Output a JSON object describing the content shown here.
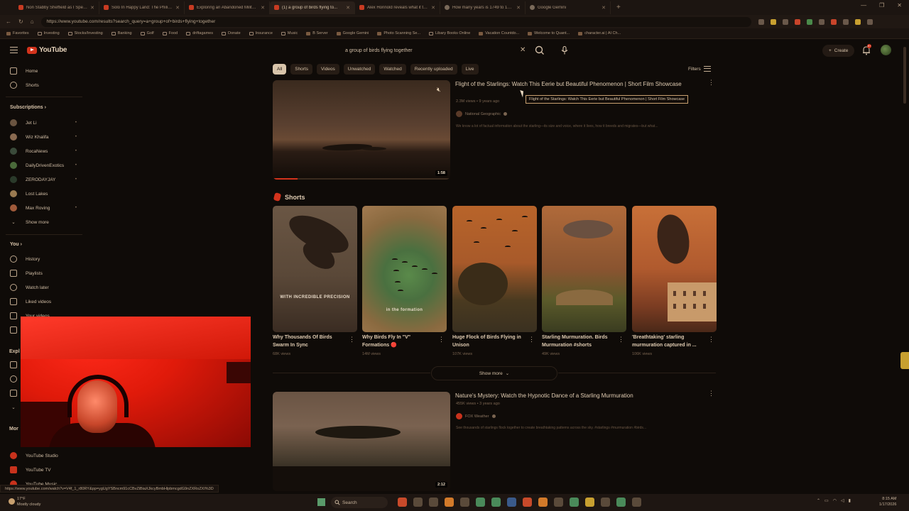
{
  "browser": {
    "tabs": [
      {
        "label": "Non Stabby Sheffield as I Speak &...",
        "icon": "youtube-icon"
      },
      {
        "label": "Solo In Happy Land: The Philippine...",
        "icon": "youtube-icon"
      },
      {
        "label": "Exploring an Abandoned Military ...",
        "icon": "youtube-icon"
      },
      {
        "label": "(1) a group of birds flying to...",
        "icon": "youtube-icon",
        "active": true
      },
      {
        "label": "Alex Honnold reveals what it takes...",
        "icon": "youtube-icon"
      },
      {
        "label": "How many years is 1749 to 1841?",
        "icon": "gemini-icon"
      },
      {
        "label": "Google Gemini",
        "icon": "gemini-icon"
      }
    ],
    "url": "https://www.youtube.com/results?search_query=a+group+of+birds+flying+together",
    "bookmarks": [
      "Favorites",
      "Investing",
      "Stocks/Investing",
      "Banking",
      "Golf",
      "Food",
      "driftagames",
      "Donate",
      "Insurance",
      "Music",
      "B Server",
      "Google Gemini",
      "Photo Scanning Se...",
      "Libary Books Online",
      "Vacation Countdo...",
      "Welcome to Quant...",
      "character.ai | AI Ch..."
    ],
    "status_url": "https://www.youtube.com/watch?v=V4f_1_r80RY&pp=ygUgYSBncm91cCBvZiBiaXJkcyBmbHlpbmcgdG9nZXRoZXI%3D"
  },
  "youtube": {
    "logo": "YouTube",
    "search_query": "a group of birds flying together",
    "create_label": "Create",
    "notification_count": "9+",
    "accent": "#d3331c"
  },
  "sidebar": {
    "home": "Home",
    "shorts": "Shorts",
    "subscriptions_head": "Subscriptions",
    "channels": [
      "Jet Li",
      "Wiz Khalifa",
      "RocaNews",
      "DailyDrivenExotics",
      "ZERODAYJAY",
      "Lost Lakes",
      "Max Roving"
    ],
    "show_more": "Show more",
    "you_head": "You",
    "you_items": [
      "History",
      "Playlists",
      "Watch later",
      "Liked videos",
      "Your videos"
    ],
    "explore_head": "Expl",
    "more_head": "Mor",
    "more_items": [
      "YouTube Studio",
      "YouTube TV",
      "YouTube Music"
    ]
  },
  "filters": {
    "chips": [
      "All",
      "Shorts",
      "Videos",
      "Unwatched",
      "Watched",
      "Recently uploaded",
      "Live"
    ],
    "filters_label": "Filters"
  },
  "results": {
    "video1": {
      "title": "Flight of the Starlings: Watch This Eerie but Beautiful Phenomenon | Short Film Showcase",
      "meta": "2.3M views • 9 years ago",
      "channel": "National Geographic",
      "description": "We know a lot of factual information about the starling—its size and voice, where it lives, how it breeds and migrates—but what...",
      "duration": "1:58",
      "tooltip": "Flight of the Starlings: Watch This Eerie but Beautiful Phenomenon | Short Film Showcase",
      "progress_fraction": 0.14
    },
    "shorts_head": "Shorts",
    "shorts": [
      {
        "title": "Why Thousands Of Birds Swarm In Sync",
        "views": "68K views",
        "caption": "WITH INCREDIBLE PRECISION"
      },
      {
        "title": "Why Birds Fly In \"V\" Formations 🔴",
        "views": "14M views",
        "caption": "in the formation"
      },
      {
        "title": "Huge Flock of Birds Flying in Unison",
        "views": "107K views",
        "caption": ""
      },
      {
        "title": "Starling Murmuration. Birds Murmuration #shorts",
        "views": "49K views",
        "caption": ""
      },
      {
        "title": "'Breathtaking' starling murmuration captured in ...",
        "views": "106K views",
        "caption": ""
      }
    ],
    "show_more": "Show more",
    "video2": {
      "title": "Nature's Mystery: Watch the Hypnotic Dance of a Starling Murmuration",
      "meta": "455K views • 3 years ago",
      "channel": "FOX Weather",
      "description": "See thousands of starlings flock together to create breathtaking patterns across the sky. #starlings #murmuration #birds...",
      "duration": "2:12"
    }
  },
  "taskbar": {
    "temp": "17°F",
    "weather": "Mostly cloudy",
    "search": "Search",
    "time": "8:15 AM",
    "date": "1/17/2026"
  }
}
